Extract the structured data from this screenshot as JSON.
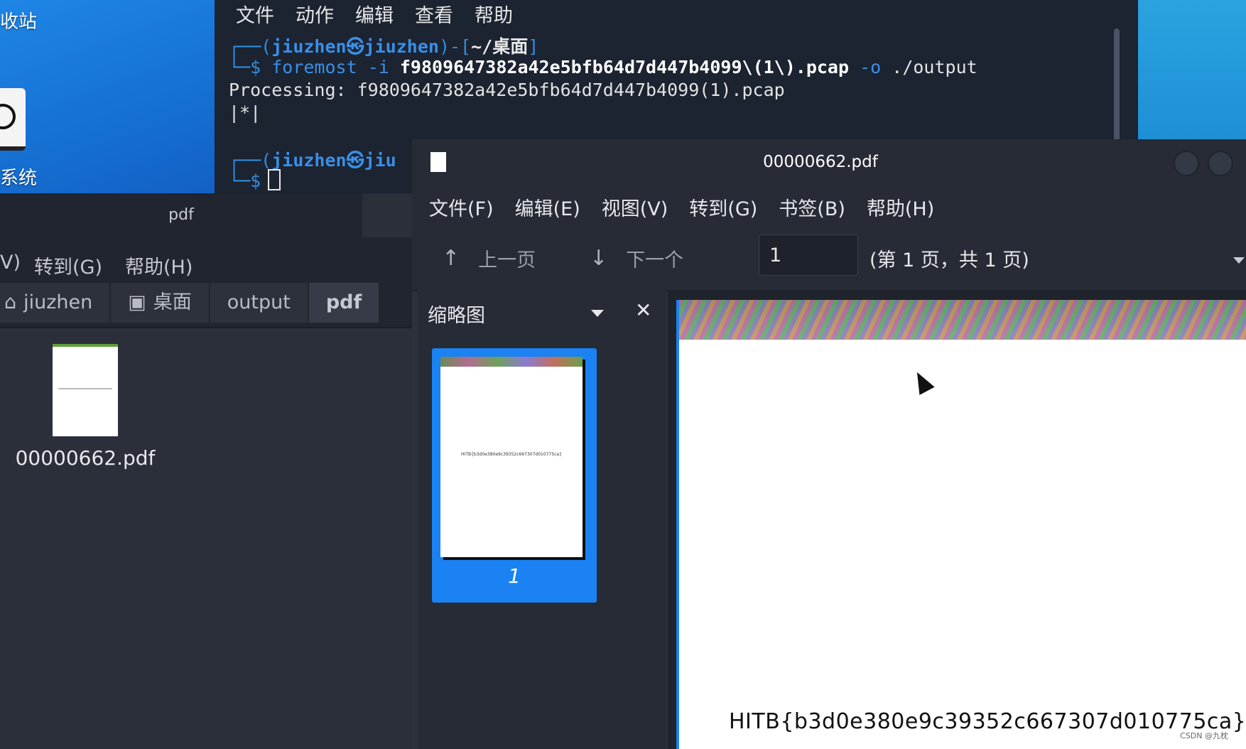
{
  "desktop": {
    "label_recycle": "收站",
    "label_system": "系统"
  },
  "terminal": {
    "menu": [
      "文件",
      "动作",
      "编辑",
      "查看",
      "帮助"
    ],
    "prompt_user": "jiuzhen㉿jiuzhen",
    "prompt_path": "~/桌面",
    "command_name": "foremost",
    "command_flag_i": "-i",
    "command_file": "f9809647382a42e5bfb64d7d447b4099\\(1\\).pcap",
    "command_flag_o": "-o",
    "command_output": "./output",
    "processing_line": "Processing: f9809647382a42e5bfb64d7d447b4099(1).pcap",
    "progress_line": "|*|",
    "prompt2_user": "jiuzhen㉿jiu"
  },
  "file_manager": {
    "title": "pdf",
    "menu_partial": "V)",
    "menu_goto": "转到(G)",
    "menu_help": "帮助(H)",
    "breadcrumbs": [
      "jiuzhen",
      "桌面",
      "output",
      "pdf"
    ],
    "file_name": "00000662.pdf"
  },
  "viewer": {
    "title": "00000662.pdf",
    "menu": [
      "文件(F)",
      "编辑(E)",
      "视图(V)",
      "转到(G)",
      "书签(B)",
      "帮助(H)"
    ],
    "prev_page": "上一页",
    "next_page": "下一个",
    "page_input": "1",
    "page_info": "(第 1 页，共 1 页)",
    "sidebar_title": "缩略图",
    "thumbnail_number": "1",
    "thumbnail_text": "HITB{b3d0e380e9c39352c667307d010775ca}",
    "document_text": "HITB{b3d0e380e9c39352c667307d010775ca}"
  },
  "watermark": "CSDN @九枕"
}
